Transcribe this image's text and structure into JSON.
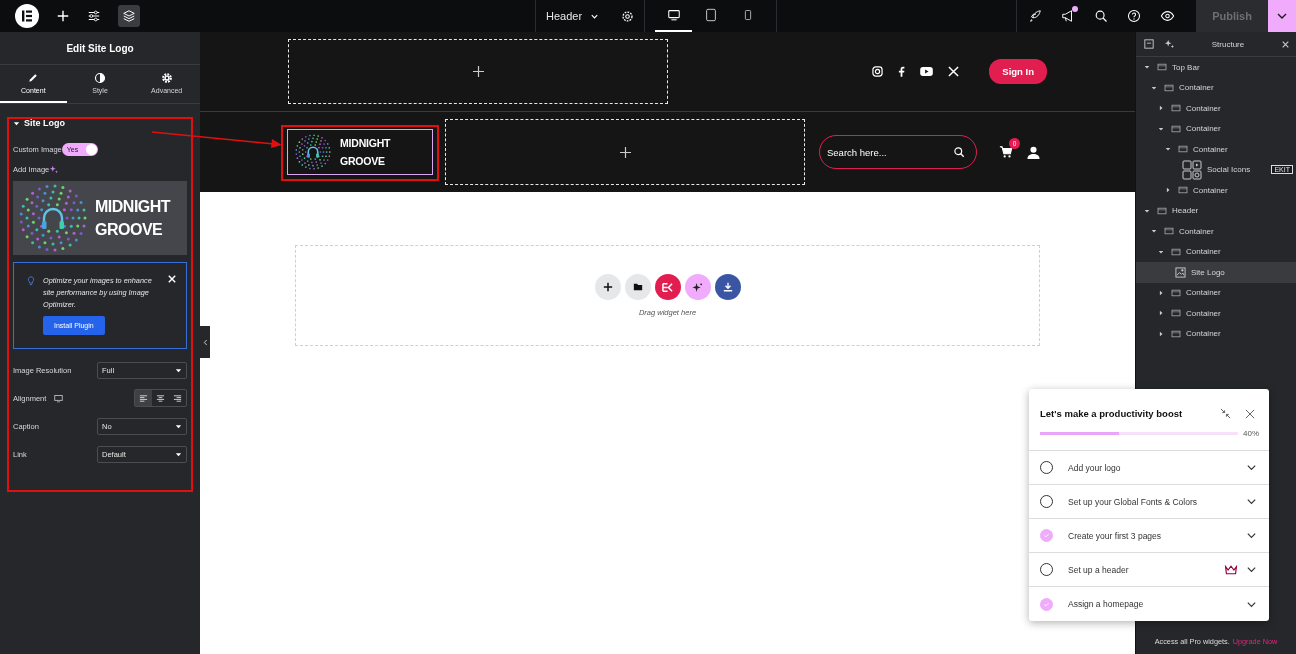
{
  "topbar": {
    "document": "Header",
    "devices": [
      {
        "kind": "desktop",
        "selected": true
      },
      {
        "kind": "tablet",
        "selected": false
      },
      {
        "kind": "mobile",
        "selected": false
      }
    ],
    "notification": true,
    "publish": {
      "label": "Publish",
      "disabled": true
    }
  },
  "editor": {
    "title": "Edit Site Logo",
    "tabs": [
      {
        "kind": "content",
        "label": "Content",
        "selected": true
      },
      {
        "kind": "style",
        "label": "Style",
        "selected": false
      },
      {
        "kind": "advanced",
        "label": "Advanced",
        "selected": false
      }
    ],
    "section": {
      "title": "Site Logo",
      "custom_image": {
        "label": "Custom Image",
        "on": true,
        "value": "Yes"
      },
      "add_image": {
        "label": "Add Image"
      },
      "logo_preview": {
        "line1": "MIDNIGHT",
        "line2": "GROOVE"
      },
      "notice": {
        "text": "Optimize your images to enhance site performance by using Image Optimizer.",
        "button": "Install Plugin"
      },
      "fields": [
        {
          "kind": "select",
          "label": "Image Resolution",
          "value": "Full"
        },
        {
          "kind": "align",
          "label": "Alignment",
          "options": [
            {
              "kind": "left",
              "selected": true
            },
            {
              "kind": "center",
              "selected": false
            },
            {
              "kind": "right",
              "selected": false
            }
          ]
        },
        {
          "kind": "select",
          "label": "Caption",
          "value": "No"
        },
        {
          "kind": "select",
          "label": "Link",
          "value": "Default"
        }
      ]
    }
  },
  "canvas": {
    "top_bar": {
      "social": [
        {
          "kind": "instagram"
        },
        {
          "kind": "facebook"
        },
        {
          "kind": "youtube"
        },
        {
          "kind": "x"
        }
      ],
      "sign_in": "Sign In"
    },
    "header": {
      "logo": {
        "line1": "MIDNIGHT",
        "line2": "GROOVE"
      },
      "search": {
        "placeholder": "Search here..."
      },
      "cart_count": "0"
    },
    "drop_zone": {
      "actions": [
        {
          "kind": "add"
        },
        {
          "kind": "folder"
        },
        {
          "kind": "kit"
        },
        {
          "kind": "ai"
        },
        {
          "kind": "import"
        }
      ],
      "hint": "Drag widget here"
    }
  },
  "structure": {
    "title": "Structure",
    "tree": [
      {
        "label": "Top Bar",
        "kind": "container",
        "expanded": true,
        "selected": false,
        "children": [
          {
            "label": "Container",
            "kind": "container",
            "expanded": true,
            "selected": false,
            "children": [
              {
                "label": "Container",
                "kind": "container",
                "expanded": false,
                "selected": false
              },
              {
                "label": "Container",
                "kind": "container",
                "expanded": true,
                "selected": false,
                "children": [
                  {
                    "label": "Container",
                    "kind": "container",
                    "expanded": true,
                    "selected": false,
                    "children": [
                      {
                        "label": "Social Icons",
                        "kind": "social",
                        "selected": false,
                        "badge": "EKIT"
                      }
                    ]
                  },
                  {
                    "label": "Container",
                    "kind": "container",
                    "expanded": false,
                    "selected": false
                  }
                ]
              }
            ]
          }
        ]
      },
      {
        "label": "Header",
        "kind": "container",
        "expanded": true,
        "selected": false,
        "children": [
          {
            "label": "Container",
            "kind": "container",
            "expanded": true,
            "selected": false,
            "children": [
              {
                "label": "Container",
                "kind": "container",
                "expanded": true,
                "selected": false,
                "children": [
                  {
                    "label": "Site Logo",
                    "kind": "logo",
                    "selected": true
                  }
                ]
              },
              {
                "label": "Container",
                "kind": "container",
                "expanded": false,
                "selected": false
              },
              {
                "label": "Container",
                "kind": "container",
                "expanded": false,
                "selected": false
              },
              {
                "label": "Container",
                "kind": "container",
                "expanded": false,
                "selected": false
              }
            ]
          }
        ]
      }
    ],
    "promo": {
      "text": "Access all Pro widgets.",
      "link": "Upgrade Now"
    }
  },
  "checklist": {
    "title": "Let's make a productivity boost",
    "level": 0.4,
    "percent": "40%",
    "items": [
      {
        "label": "Add your logo",
        "done": false,
        "pro": false
      },
      {
        "label": "Set up your Global Fonts & Colors",
        "done": false,
        "pro": false
      },
      {
        "label": "Create your first 3 pages",
        "done": true,
        "pro": false
      },
      {
        "label": "Set up a header",
        "done": false,
        "pro": true
      },
      {
        "label": "Assign a homepage",
        "done": true,
        "pro": false
      }
    ]
  }
}
